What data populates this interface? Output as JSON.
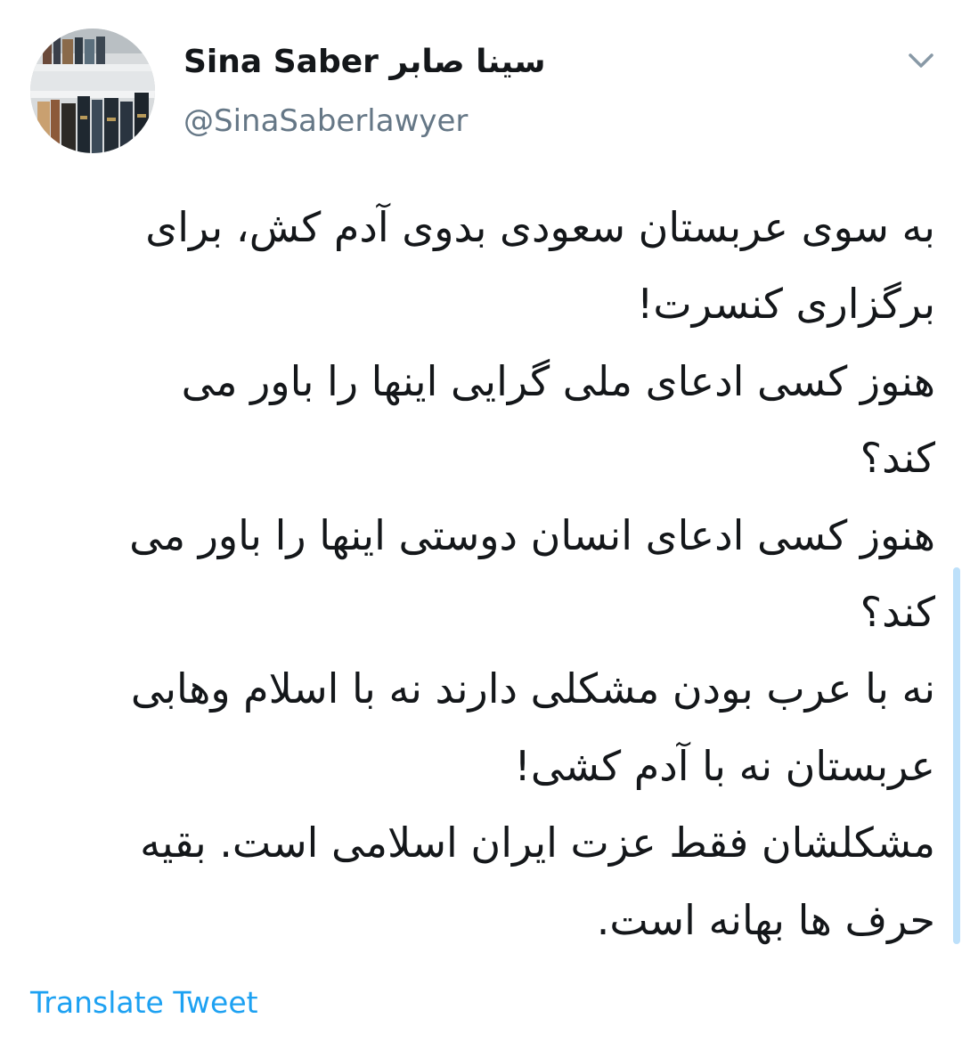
{
  "author": {
    "name": "Sina Saber سینا صابر",
    "handle": "@SinaSaberlawyer"
  },
  "tweet": {
    "lines": [
      "به سوی عربستان سعودی بدوی آدم کش، برای",
      "برگزاری کنسرت!",
      "هنوز کسی ادعای ملی گرایی اینها را باور می",
      "کند؟",
      "هنوز کسی ادعای انسان دوستی اینها را باور می",
      "کند؟",
      "نه با عرب بودن مشکلی دارند نه با اسلام وهابی",
      "عربستان نه با آدم کشی!",
      "مشکلشان فقط عزت ایران اسلامی است. بقیه",
      "حرف ها بهانه است."
    ]
  },
  "actions": {
    "translate_label": "Translate Tweet"
  },
  "icons": {
    "menu": "chevron-down-icon",
    "avatar": "bookshelf-avatar"
  },
  "colors": {
    "link": "#1da1f2",
    "secondary_text": "#657786",
    "primary_text": "#14171a"
  }
}
